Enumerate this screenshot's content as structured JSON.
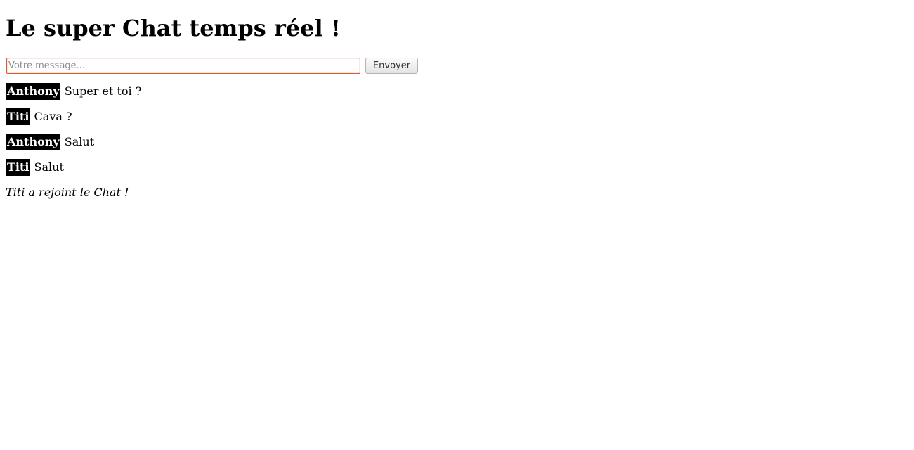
{
  "page": {
    "title": "Le super Chat temps réel !"
  },
  "form": {
    "input_placeholder": "Votre message...",
    "input_value": "",
    "send_label": "Envoyer"
  },
  "messages": [
    {
      "user": "Anthony",
      "text": "Super et toi ?"
    },
    {
      "user": "Titi",
      "text": "Cava ?"
    },
    {
      "user": "Anthony",
      "text": "Salut"
    },
    {
      "user": "Titi",
      "text": "Salut"
    }
  ],
  "system_message": "Titi a rejoint le Chat !",
  "colors": {
    "input_focus_border": "#d95d2e",
    "pseudo_background": "#000000",
    "pseudo_text": "#ffffff"
  }
}
